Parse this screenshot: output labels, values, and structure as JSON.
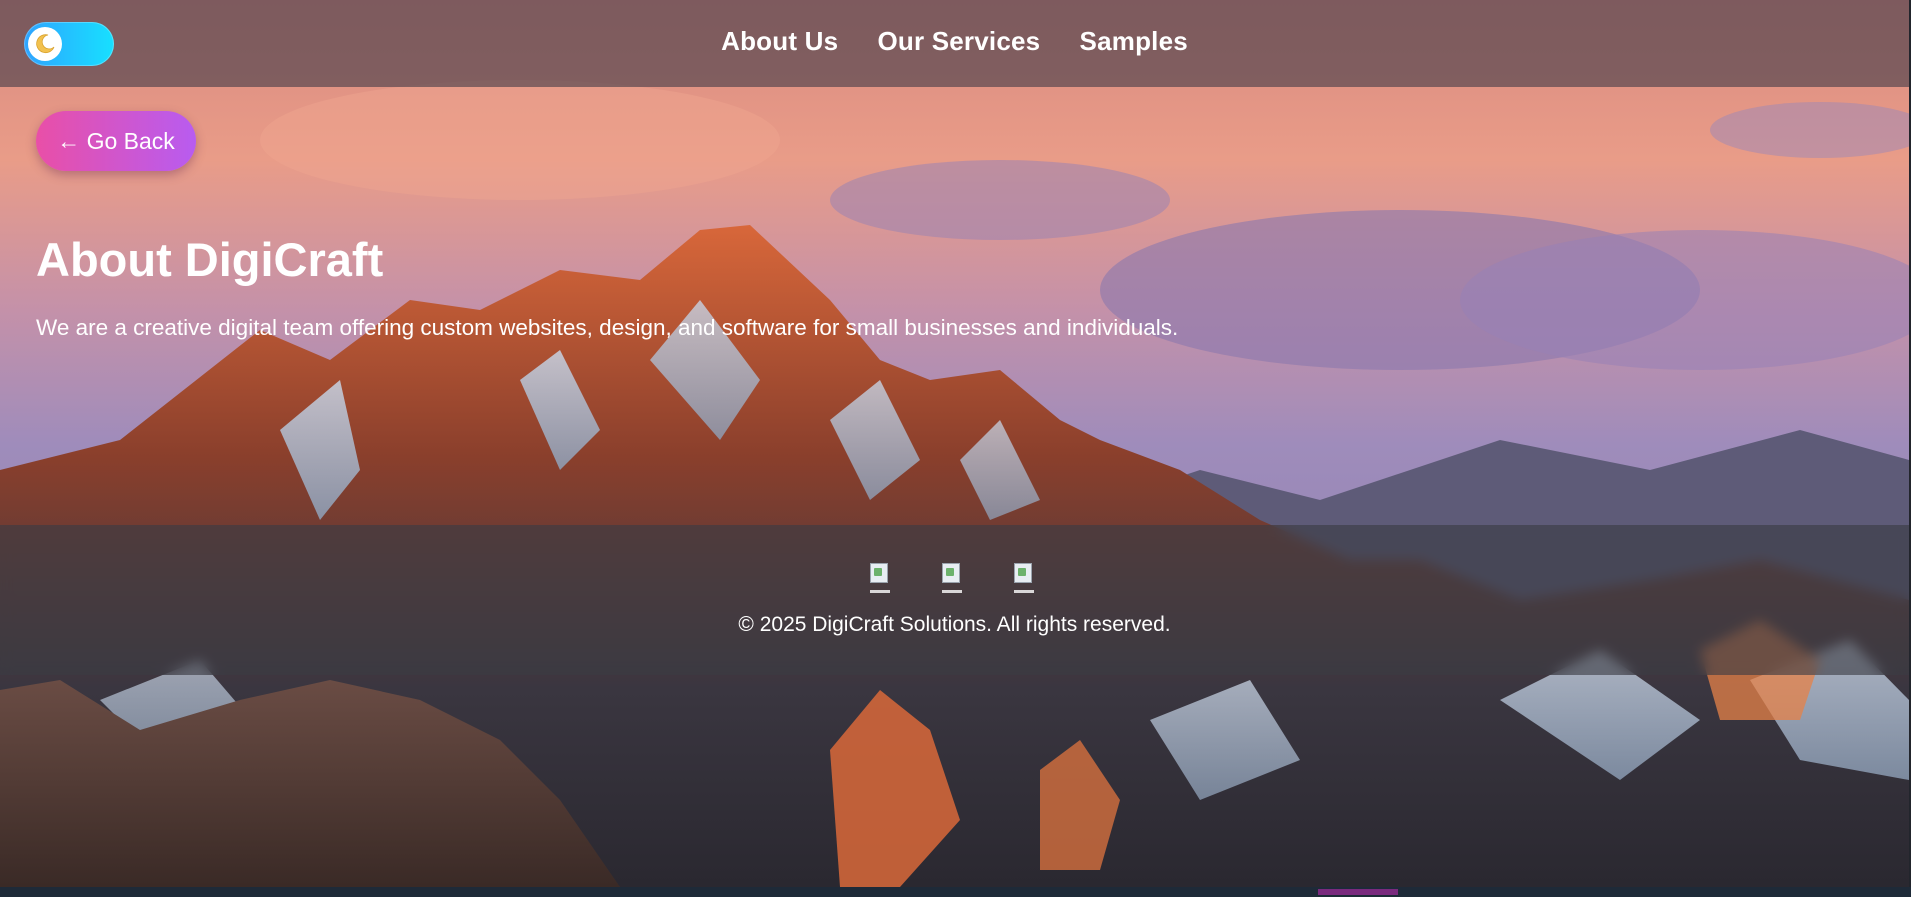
{
  "header": {
    "theme_toggle": {
      "icon": "moon-icon",
      "state": "dark"
    },
    "nav": [
      {
        "label": "About Us"
      },
      {
        "label": "Our Services"
      },
      {
        "label": "Samples"
      }
    ]
  },
  "main": {
    "back_button": "← Go Back",
    "title": "About DigiCraft",
    "description": "We are a creative digital team offering custom websites, design, and software for small businesses and individuals."
  },
  "footer": {
    "social_icons": [
      "facebook-icon",
      "instagram-icon",
      "linkedin-icon"
    ],
    "copyright": "© 2025 DigiCraft Solutions. All rights reserved."
  },
  "colors": {
    "toggle_gradient": [
      "#2fa4ff",
      "#17e0ff"
    ],
    "back_button_gradient": [
      "#e94fa7",
      "#b85cf0"
    ],
    "text": "#ffffff"
  }
}
